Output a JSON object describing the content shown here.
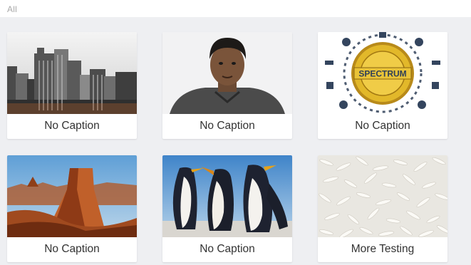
{
  "filter": {
    "label": "All"
  },
  "gallery": {
    "items": [
      {
        "caption": "No Caption",
        "image": "city-skyline-photo"
      },
      {
        "caption": "No Caption",
        "image": "portrait-photo"
      },
      {
        "caption": "No Caption",
        "image": "spectrum-seal-logo",
        "logo_text": "SPECTRUM"
      },
      {
        "caption": "No Caption",
        "image": "desert-butte-photo"
      },
      {
        "caption": "No Caption",
        "image": "penguins-photo"
      },
      {
        "caption": "More Testing",
        "image": "rice-grains-photo"
      }
    ]
  },
  "colors": {
    "background": "#eeeff2",
    "card": "#ffffff",
    "caption_text": "#333333",
    "filter_text": "#a8a8a8"
  }
}
